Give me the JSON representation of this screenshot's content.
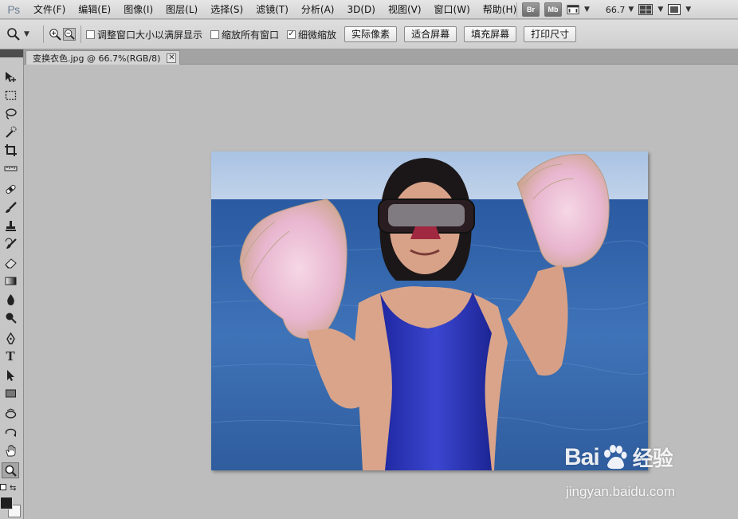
{
  "app": {
    "logo": "Ps"
  },
  "menu": [
    "文件(F)",
    "编辑(E)",
    "图像(I)",
    "图层(L)",
    "选择(S)",
    "滤镜(T)",
    "分析(A)",
    "3D(D)",
    "视图(V)",
    "窗口(W)",
    "帮助(H)"
  ],
  "app_bar": {
    "bridge_label": "Br",
    "minibridge_label": "Mb",
    "zoom_value": "66.7"
  },
  "options": {
    "resize_windows": {
      "label": "调整窗口大小以满屏显示",
      "checked": false
    },
    "zoom_all": {
      "label": "缩放所有窗口",
      "checked": false
    },
    "scrubby_zoom": {
      "label": "细微缩放",
      "checked": true
    },
    "buttons": [
      "实际像素",
      "适合屏幕",
      "填充屏幕",
      "打印尺寸"
    ]
  },
  "document": {
    "tab_title": "变换衣色.jpg @ 66.7%(RGB/8)",
    "close_glyph": "✕"
  },
  "tools": [
    "move-icon",
    "marquee-icon",
    "lasso-icon",
    "quick-selection-icon",
    "crop-icon",
    "ruler-icon",
    "healing-brush-icon",
    "brush-icon",
    "clone-stamp-icon",
    "history-brush-icon",
    "eraser-icon",
    "gradient-icon",
    "blur-icon",
    "dodge-icon",
    "pen-icon",
    "type-icon",
    "path-selection-icon",
    "rectangle-icon",
    "3d-rotate-icon",
    "3d-orbit-icon",
    "hand-icon",
    "zoom-icon"
  ],
  "tool_type_glyph": "T",
  "active_tool": "zoom-icon",
  "colors": {
    "foreground": "#1f1f1f",
    "background": "#f7f7f7",
    "swimsuit": "#2d36b8",
    "sea": "#2e62a6"
  },
  "watermark": {
    "brand_prefix": "Bai",
    "brand_suffix": "经验",
    "url": "jingyan.baidu.com"
  }
}
